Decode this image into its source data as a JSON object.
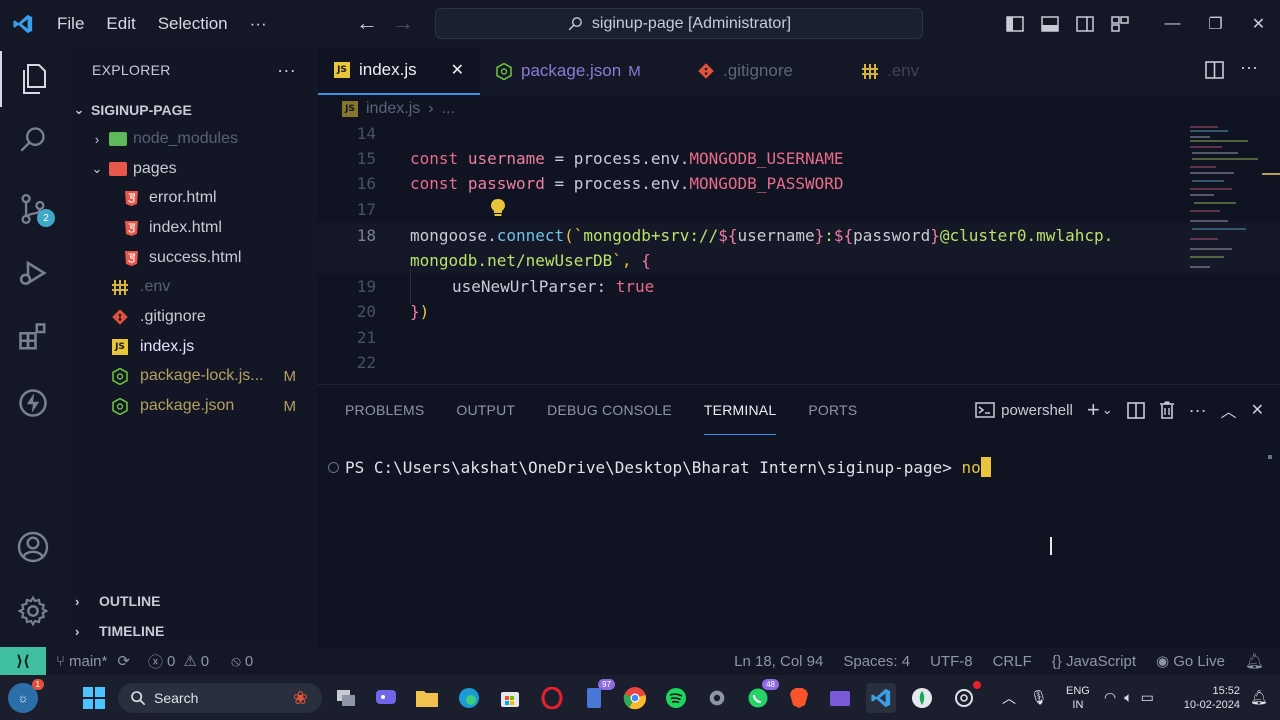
{
  "titlebar": {
    "menu": [
      "File",
      "Edit",
      "Selection",
      "···"
    ],
    "command_center": "siginup-page [Administrator]"
  },
  "activity": {
    "source_control_badge": "2"
  },
  "sidebar": {
    "title": "EXPLORER",
    "more": "···",
    "root": "SIGINUP-PAGE",
    "items": [
      {
        "label": "node_modules",
        "kind": "folder",
        "color": "#5fb85a"
      },
      {
        "label": "pages",
        "kind": "folder-open",
        "color": "#e8584a"
      },
      {
        "label": "error.html",
        "kind": "html"
      },
      {
        "label": "index.html",
        "kind": "html"
      },
      {
        "label": "success.html",
        "kind": "html"
      },
      {
        "label": ".env",
        "kind": "env"
      },
      {
        "label": ".gitignore",
        "kind": "git"
      },
      {
        "label": "index.js",
        "kind": "js"
      },
      {
        "label": "package-lock.js...",
        "kind": "json",
        "mark": "M"
      },
      {
        "label": "package.json",
        "kind": "json",
        "mark": "M"
      }
    ],
    "outline": "OUTLINE",
    "timeline": "TIMELINE"
  },
  "tabs": [
    {
      "label": "index.js",
      "active": true,
      "close": "✕"
    },
    {
      "label": "package.json",
      "mark": "M"
    },
    {
      "label": ".gitignore"
    },
    {
      "label": ".env"
    }
  ],
  "breadcrumb": {
    "file": "index.js",
    "rest": "..."
  },
  "code": {
    "lines": [
      "14",
      "15",
      "16",
      "17",
      "18",
      "",
      "19",
      "20",
      "21",
      "22"
    ],
    "l15": {
      "kw": "const",
      "var": "username",
      "eq": " = ",
      "obj": "process.env.",
      "prop": "MONGODB_USERNAME"
    },
    "l16": {
      "kw": "const",
      "var": "password",
      "eq": " = ",
      "obj": "process.env.",
      "prop": "MONGODB_PASSWORD"
    },
    "l18": {
      "obj": "mongoose.",
      "fn": "connect",
      "open": "(`",
      "s1": "mongodb+srv://",
      "t1": "${",
      "v1": "username",
      "t1c": "}",
      "s2": ":",
      "t2": "${",
      "v2": "password",
      "t2c": "}",
      "s3": "@cluster0.mwlahcp."
    },
    "l18b": {
      "s4": "mongodb.net/newUserDB",
      "close": "`, ",
      "brace": "{"
    },
    "l19": {
      "key": "useNewUrlParser",
      "colon": ": ",
      "val": "true"
    },
    "l20": {
      "brace": "}",
      "paren": ")"
    }
  },
  "panel": {
    "tabs": [
      "PROBLEMS",
      "OUTPUT",
      "DEBUG CONSOLE",
      "TERMINAL",
      "PORTS"
    ],
    "shell": "powershell",
    "prompt": "PS C:\\Users\\akshat\\OneDrive\\Desktop\\Bharat Intern\\siginup-page> ",
    "typed": "no"
  },
  "statusbar": {
    "branch": "main*",
    "errors": "0",
    "warnings": "0",
    "ports": "0",
    "position": "Ln 18, Col 94",
    "spaces": "Spaces: 4",
    "encoding": "UTF-8",
    "eol": "CRLF",
    "language": "JavaScript",
    "golive": "Go Live"
  },
  "taskbar": {
    "search": "Search",
    "badge_chat": "97",
    "badge_whatsapp": "48",
    "lang": "ENG",
    "region": "IN",
    "time": "15:52",
    "date": "10-02-2024"
  }
}
